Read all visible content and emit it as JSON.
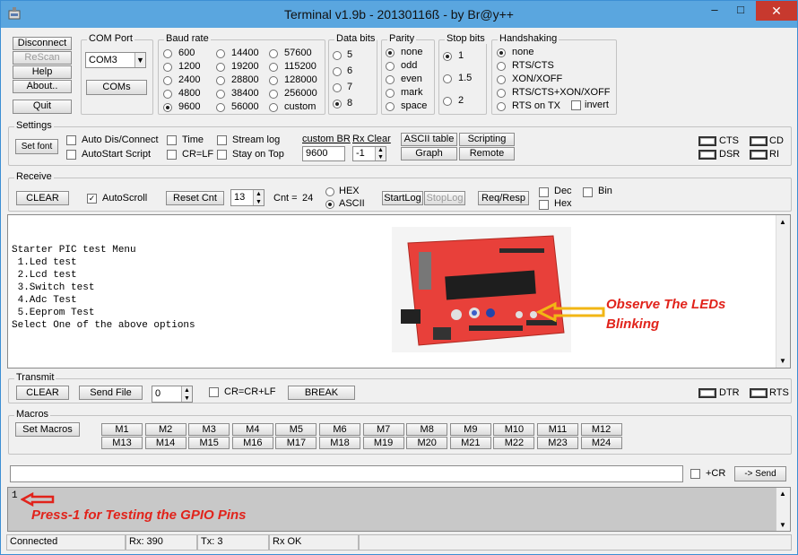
{
  "window": {
    "title": "Terminal v1.9b - 20130116ß - by Br@y++",
    "min": "–",
    "max": "□",
    "close": "✕"
  },
  "connect": {
    "disconnect": "Disconnect",
    "rescan": "ReScan",
    "help": "Help",
    "about": "About..",
    "quit": "Quit"
  },
  "comport": {
    "title": "COM Port",
    "value": "COM3",
    "coms": "COMs"
  },
  "baud": {
    "title": "Baud rate",
    "options": [
      [
        "600",
        "14400",
        "57600"
      ],
      [
        "1200",
        "19200",
        "115200"
      ],
      [
        "2400",
        "28800",
        "128000"
      ],
      [
        "4800",
        "38400",
        "256000"
      ],
      [
        "9600",
        "56000",
        "custom"
      ]
    ],
    "selected": "9600"
  },
  "databits": {
    "title": "Data bits",
    "options": [
      "5",
      "6",
      "7",
      "8"
    ],
    "selected": "8"
  },
  "parity": {
    "title": "Parity",
    "options": [
      "none",
      "odd",
      "even",
      "mark",
      "space"
    ],
    "selected": "none"
  },
  "stopbits": {
    "title": "Stop bits",
    "options": [
      "1",
      "1.5",
      "2"
    ],
    "selected": "1"
  },
  "handshaking": {
    "title": "Handshaking",
    "options": [
      "none",
      "RTS/CTS",
      "XON/XOFF",
      "RTS/CTS+XON/XOFF",
      "RTS on TX"
    ],
    "invert": "invert",
    "selected": "none"
  },
  "settings": {
    "title": "Settings",
    "setfont": "Set font",
    "auto_dis": "Auto Dis/Connect",
    "autostart": "AutoStart Script",
    "time": "Time",
    "crlf": "CR=LF",
    "streamlog": "Stream log",
    "stayontop": "Stay on Top",
    "custombr_label": "custom BR",
    "custombr_value": "9600",
    "rxclear_label": "Rx Clear",
    "rxclear_value": "-1",
    "ascii_table": "ASCII table",
    "graph": "Graph",
    "scripting": "Scripting",
    "remote": "Remote"
  },
  "signals": {
    "cts": "CTS",
    "cd": "CD",
    "dsr": "DSR",
    "ri": "RI",
    "dtr": "DTR",
    "rts": "RTS"
  },
  "receive": {
    "title": "Receive",
    "clear": "CLEAR",
    "autoscroll": "AutoScroll",
    "resetcnt": "Reset Cnt",
    "cnt_spin": "13",
    "cnt_label": "Cnt =",
    "cnt_value": "24",
    "hex": "HEX",
    "ascii": "ASCII",
    "startlog": "StartLog",
    "stoplog": "StopLog",
    "reqresp": "Req/Resp",
    "dec": "Dec",
    "hexchk": "Hex",
    "bin": "Bin",
    "text": "\n\nStarter PIC test Menu\n 1.Led test\n 2.Lcd test\n 3.Switch test\n 4.Adc Test\n 5.Eeprom Test\nSelect One of the above options"
  },
  "annotation_leds": "Observe The LEDs\nBlinking",
  "transmit": {
    "title": "Transmit",
    "clear": "CLEAR",
    "sendfile": "Send File",
    "spin": "0",
    "crcrlf": "CR=CR+LF",
    "break": "BREAK"
  },
  "macros": {
    "title": "Macros",
    "set": "Set Macros",
    "row1": [
      "M1",
      "M2",
      "M3",
      "M4",
      "M5",
      "M6",
      "M7",
      "M8",
      "M9",
      "M10",
      "M11",
      "M12"
    ],
    "row2": [
      "M13",
      "M14",
      "M15",
      "M16",
      "M17",
      "M18",
      "M19",
      "M20",
      "M21",
      "M22",
      "M23",
      "M24"
    ]
  },
  "send": {
    "input": "",
    "cr": "+CR",
    "button": "-> Send"
  },
  "txlog": {
    "text": "1",
    "annotation": "Press-1 for Testing the GPIO Pins"
  },
  "statusbar": {
    "connected": "Connected",
    "rx": "Rx: 390",
    "tx": "Tx: 3",
    "rxok": "Rx OK"
  },
  "colors": {
    "titlebar": "#5aa6df",
    "annotation": "#e1231b",
    "board": "#e8403a",
    "arrow": "#f2b614"
  }
}
